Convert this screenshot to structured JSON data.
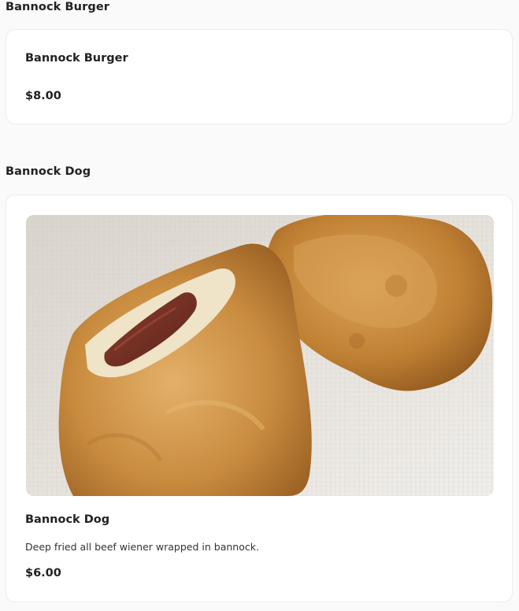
{
  "sections": [
    {
      "title": "Bannock Burger",
      "item": {
        "name": "Bannock Burger",
        "price": "$8.00"
      }
    },
    {
      "title": "Bannock Dog",
      "item": {
        "name": "Bannock Dog",
        "description": "Deep fried all beef wiener wrapped in bannock.",
        "price": "$6.00",
        "image_icon": "food-photo"
      }
    }
  ]
}
